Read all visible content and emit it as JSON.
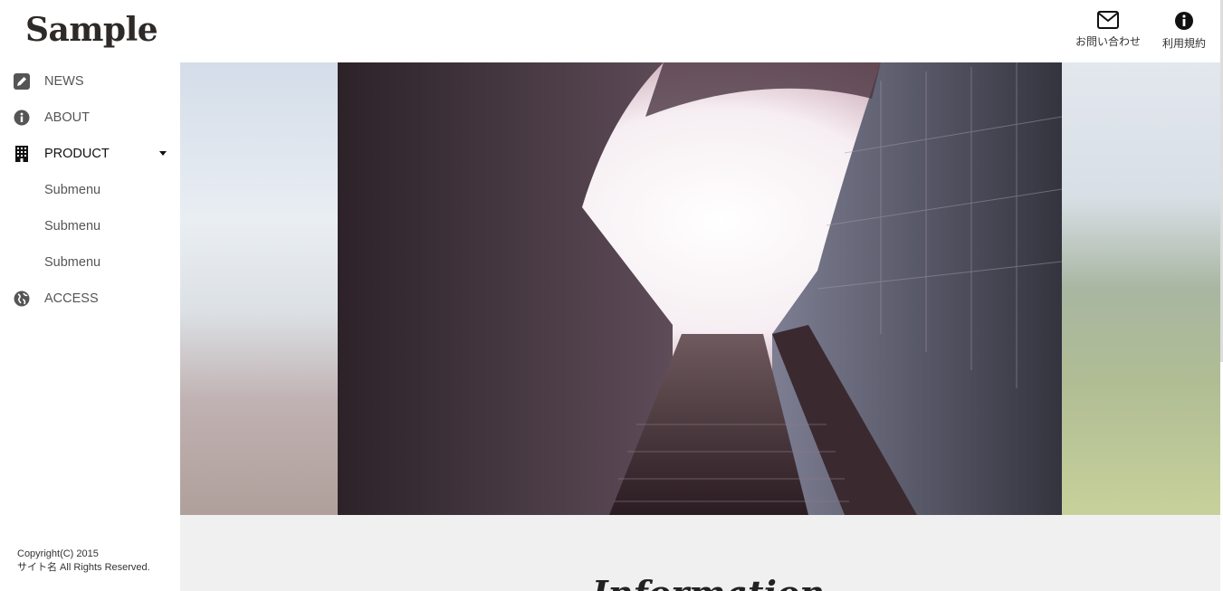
{
  "brand": {
    "logo": "Sample"
  },
  "header": {
    "links": [
      {
        "label": "お問い合わせ",
        "icon": "envelope-icon"
      },
      {
        "label": "利用規約",
        "icon": "info-circle-icon"
      }
    ]
  },
  "sidebar": {
    "items": [
      {
        "label": "NEWS",
        "icon": "pencil-icon"
      },
      {
        "label": "ABOUT",
        "icon": "info-circle-icon"
      },
      {
        "label": "PRODUCT",
        "icon": "building-icon",
        "expanded": true
      },
      {
        "label": "ACCESS",
        "icon": "globe-icon"
      }
    ],
    "submenu": [
      "Submenu",
      "Submenu",
      "Submenu"
    ]
  },
  "footer": {
    "copyright": "Copyright(C) 2015",
    "rights": "サイト名 All Rights Reserved."
  },
  "main": {
    "heading": "Information"
  },
  "colors": {
    "accent": "#2d2a28",
    "content_bg": "#f0f0f0"
  }
}
